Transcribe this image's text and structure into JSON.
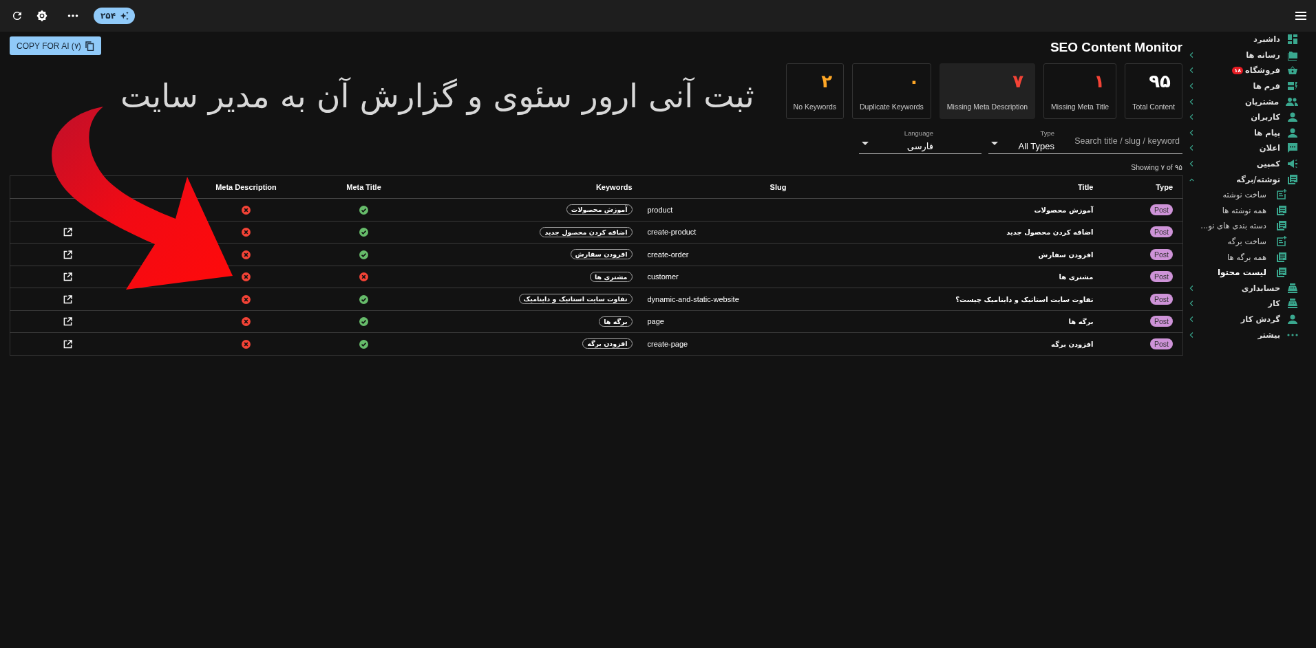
{
  "topbar": {
    "credits": "۲۵۴"
  },
  "copy_button": {
    "label": "COPY FOR AI (۷)"
  },
  "page_title": "SEO Content Monitor",
  "annotation": "ثبت آنی ارور سئوی و گزارش آن به مدیر سایت",
  "stats": [
    {
      "value": "۹۵",
      "label": "Total Content",
      "color": "#ffffff",
      "selected": false
    },
    {
      "value": "۱",
      "label": "Missing Meta Title",
      "color": "#f44336",
      "selected": false
    },
    {
      "value": "۷",
      "label": "Missing Meta Description",
      "color": "#f44336",
      "selected": true
    },
    {
      "value": "۰",
      "label": "Duplicate Keywords",
      "color": "#ffa726",
      "selected": false
    },
    {
      "value": "۲",
      "label": "No Keywords",
      "color": "#ffa726",
      "selected": false
    }
  ],
  "filters": {
    "language": {
      "label": "Language",
      "value": "فارسی"
    },
    "type": {
      "label": "Type",
      "value": "All Types"
    },
    "search": {
      "placeholder": "Search title / slug / keyword"
    }
  },
  "showing": "Showing ۷ of ۹۵",
  "table": {
    "columns": [
      "Type",
      "Title",
      "Slug",
      "Keywords",
      "Meta Title",
      "Meta Description"
    ],
    "rows": [
      {
        "open_link": false,
        "meta_description": false,
        "meta_title": true,
        "keyword": "آموزش محصولات",
        "slug": "product",
        "title": "آموزش محصولات",
        "type": "Post"
      },
      {
        "open_link": true,
        "meta_description": false,
        "meta_title": true,
        "keyword": "اضافه کردن محصول جدید",
        "slug": "create-product",
        "title": "اضافه کردن محصول جدید",
        "type": "Post"
      },
      {
        "open_link": true,
        "meta_description": false,
        "meta_title": true,
        "keyword": "افزودن سفارش",
        "slug": "create-order",
        "title": "افزودن سفارش",
        "type": "Post"
      },
      {
        "open_link": true,
        "meta_description": false,
        "meta_title": false,
        "keyword": "مشتری ها",
        "slug": "customer",
        "title": "مشتری ها",
        "type": "Post"
      },
      {
        "open_link": true,
        "meta_description": false,
        "meta_title": true,
        "keyword": "تفاوت سایت استاتیک و داینامیک",
        "slug": "dynamic-and-static-website",
        "title": "تفاوت سایت استاتیک و داینامیک چیست؟",
        "type": "Post"
      },
      {
        "open_link": true,
        "meta_description": false,
        "meta_title": true,
        "keyword": "برگه ها",
        "slug": "page",
        "title": "برگه ها",
        "type": "Post"
      },
      {
        "open_link": true,
        "meta_description": false,
        "meta_title": true,
        "keyword": "افزودن برگه",
        "slug": "create-page",
        "title": "افزودن برگه",
        "type": "Post"
      }
    ]
  },
  "sidebar": {
    "items": [
      {
        "label": "داشبرد"
      },
      {
        "label": "رسانه ها",
        "expanded": false
      },
      {
        "label": "فروشگاه",
        "badge": "۱۸",
        "expanded": false
      },
      {
        "label": "فرم ها",
        "expanded": false
      },
      {
        "label": "مشتریان",
        "expanded": false
      },
      {
        "label": "کاربران",
        "expanded": false
      },
      {
        "label": "پیام ها",
        "expanded": false
      },
      {
        "label": "اعلان",
        "expanded": false
      },
      {
        "label": "کمپین",
        "expanded": false
      },
      {
        "label": "نوشته/برگه",
        "expanded": true,
        "children": [
          {
            "label": "ساخت نوشته",
            "selected": false
          },
          {
            "label": "همه نوشته ها",
            "selected": false
          },
          {
            "label": "دسته بندی های نو...",
            "selected": false
          },
          {
            "label": "ساخت برگه",
            "selected": false
          },
          {
            "label": "همه برگه ها",
            "selected": false
          },
          {
            "label": "لیست محتوا",
            "selected": true
          }
        ]
      },
      {
        "label": "حسابداری",
        "expanded": false
      },
      {
        "label": "کار",
        "expanded": false
      },
      {
        "label": "گردش کار",
        "expanded": false
      },
      {
        "label": "بیشتر",
        "expanded": false
      }
    ]
  }
}
